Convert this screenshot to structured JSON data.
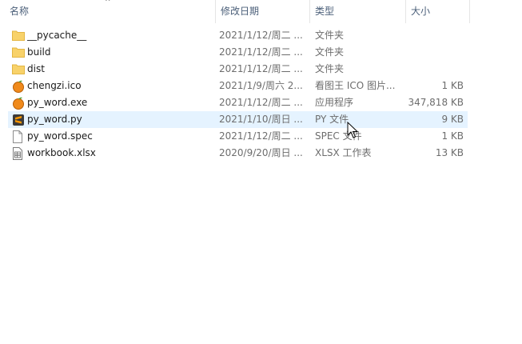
{
  "columns": {
    "name": "名称",
    "date": "修改日期",
    "type": "类型",
    "size": "大小"
  },
  "sort_indicator": "^",
  "files": [
    {
      "name": "__pycache__",
      "date": "2021/1/12/周二 ...",
      "type": "文件夹",
      "size": "",
      "icon": "folder-icon"
    },
    {
      "name": "build",
      "date": "2021/1/12/周二 ...",
      "type": "文件夹",
      "size": "",
      "icon": "folder-icon"
    },
    {
      "name": "dist",
      "date": "2021/1/12/周二 ...",
      "type": "文件夹",
      "size": "",
      "icon": "folder-icon"
    },
    {
      "name": "chengzi.ico",
      "date": "2021/1/9/周六 2...",
      "type": "看图王 ICO 图片...",
      "size": "1 KB",
      "icon": "orange-icon"
    },
    {
      "name": "py_word.exe",
      "date": "2021/1/12/周二 ...",
      "type": "应用程序",
      "size": "347,818 KB",
      "icon": "orange-icon"
    },
    {
      "name": "py_word.py",
      "date": "2021/1/10/周日 ...",
      "type": "PY 文件",
      "size": "9 KB",
      "icon": "sublime-icon"
    },
    {
      "name": "py_word.spec",
      "date": "2021/1/12/周二 ...",
      "type": "SPEC 文件",
      "size": "1 KB",
      "icon": "blank-file-icon"
    },
    {
      "name": "workbook.xlsx",
      "date": "2020/9/20/周日 ...",
      "type": "XLSX 工作表",
      "size": "13 KB",
      "icon": "spreadsheet-icon"
    }
  ],
  "selected_file": "py_word.py",
  "colors": {
    "folder": "#f8d26a",
    "orange": "#f08a1c",
    "selected_row": "#e5f3ff",
    "header_text": "#4c607a"
  }
}
